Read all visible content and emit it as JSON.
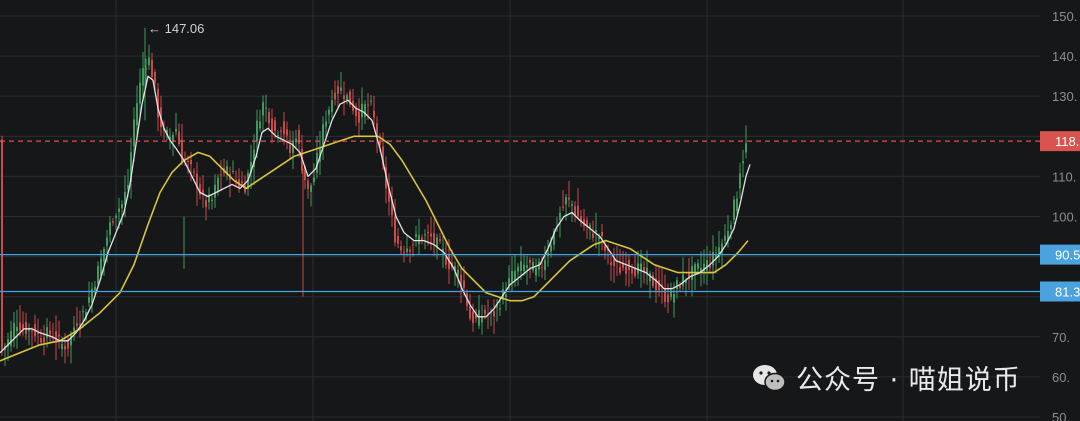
{
  "chart_data": {
    "type": "candlestick",
    "ylim": [
      49,
      154
    ],
    "y_ticks": [
      50,
      60,
      70,
      80,
      90,
      100,
      110,
      120,
      130,
      140,
      150
    ],
    "y_tick_labels": [
      "50.",
      "60.",
      "70.",
      "80.",
      "90.",
      "100.",
      "110.",
      "120.",
      "130.",
      "140.",
      "150."
    ],
    "grid": true,
    "peak_annotation": {
      "label": "← 147.06",
      "value": 147.06
    },
    "horizontal_levels": [
      {
        "value": 118.8,
        "label": "118.",
        "style": "dashed",
        "color": "#d9534f"
      },
      {
        "value": 90.5,
        "label": "90.5",
        "style": "solid",
        "color": "#4aa3df"
      },
      {
        "value": 81.3,
        "label": "81.3",
        "style": "solid",
        "color": "#4aa3df"
      }
    ],
    "price_path": [
      [
        0,
        66
      ],
      [
        8,
        69
      ],
      [
        16,
        74
      ],
      [
        24,
        72
      ],
      [
        32,
        72
      ],
      [
        40,
        70
      ],
      [
        52,
        71
      ],
      [
        60,
        68
      ],
      [
        68,
        68
      ],
      [
        76,
        74
      ],
      [
        84,
        76
      ],
      [
        92,
        82
      ],
      [
        100,
        88
      ],
      [
        108,
        96
      ],
      [
        114,
        101
      ],
      [
        122,
        103
      ],
      [
        128,
        108
      ],
      [
        134,
        124
      ],
      [
        138,
        130
      ],
      [
        143,
        137
      ],
      [
        148,
        140
      ],
      [
        153,
        135
      ],
      [
        158,
        126
      ],
      [
        164,
        120
      ],
      [
        170,
        120
      ],
      [
        176,
        122
      ],
      [
        182,
        115
      ],
      [
        190,
        112
      ],
      [
        198,
        108
      ],
      [
        204,
        103
      ],
      [
        212,
        104
      ],
      [
        220,
        111
      ],
      [
        230,
        111
      ],
      [
        240,
        108
      ],
      [
        246,
        108
      ],
      [
        252,
        115
      ],
      [
        258,
        124
      ],
      [
        263,
        128
      ],
      [
        268,
        126
      ],
      [
        274,
        121
      ],
      [
        282,
        123
      ],
      [
        290,
        116
      ],
      [
        296,
        121
      ],
      [
        302,
        113
      ],
      [
        308,
        106
      ],
      [
        314,
        110
      ],
      [
        320,
        118
      ],
      [
        326,
        125
      ],
      [
        334,
        131
      ],
      [
        340,
        132
      ],
      [
        346,
        130
      ],
      [
        352,
        128
      ],
      [
        358,
        125
      ],
      [
        364,
        127
      ],
      [
        370,
        128
      ],
      [
        376,
        122
      ],
      [
        382,
        113
      ],
      [
        388,
        105
      ],
      [
        394,
        96
      ],
      [
        400,
        92
      ],
      [
        410,
        93
      ],
      [
        420,
        95
      ],
      [
        430,
        95
      ],
      [
        440,
        92
      ],
      [
        450,
        88
      ],
      [
        458,
        86
      ],
      [
        464,
        82
      ],
      [
        470,
        75
      ],
      [
        476,
        74
      ],
      [
        484,
        76
      ],
      [
        492,
        75
      ],
      [
        500,
        79
      ],
      [
        508,
        83
      ],
      [
        514,
        86
      ],
      [
        520,
        87
      ],
      [
        528,
        88
      ],
      [
        536,
        86
      ],
      [
        542,
        88
      ],
      [
        548,
        92
      ],
      [
        554,
        96
      ],
      [
        560,
        101
      ],
      [
        566,
        104
      ],
      [
        572,
        103
      ],
      [
        578,
        100
      ],
      [
        586,
        97
      ],
      [
        594,
        96
      ],
      [
        600,
        95
      ],
      [
        606,
        91
      ],
      [
        612,
        88
      ],
      [
        620,
        87
      ],
      [
        628,
        88
      ],
      [
        636,
        87
      ],
      [
        644,
        86
      ],
      [
        652,
        84
      ],
      [
        660,
        82
      ],
      [
        666,
        80
      ],
      [
        672,
        80
      ],
      [
        678,
        83
      ],
      [
        686,
        85
      ],
      [
        694,
        86
      ],
      [
        700,
        87
      ],
      [
        706,
        88
      ],
      [
        712,
        89
      ],
      [
        718,
        92
      ],
      [
        724,
        94
      ],
      [
        730,
        99
      ],
      [
        736,
        104
      ],
      [
        740,
        112
      ],
      [
        744,
        116
      ],
      [
        748,
        119
      ]
    ],
    "ma_fast": [
      [
        0,
        66
      ],
      [
        8,
        68
      ],
      [
        16,
        70
      ],
      [
        24,
        72
      ],
      [
        32,
        72
      ],
      [
        40,
        71
      ],
      [
        52,
        70
      ],
      [
        60,
        69
      ],
      [
        68,
        69
      ],
      [
        76,
        71
      ],
      [
        84,
        74
      ],
      [
        92,
        78
      ],
      [
        100,
        84
      ],
      [
        108,
        91
      ],
      [
        116,
        96
      ],
      [
        124,
        101
      ],
      [
        130,
        108
      ],
      [
        136,
        118
      ],
      [
        142,
        128
      ],
      [
        148,
        135
      ],
      [
        153,
        134
      ],
      [
        158,
        127
      ],
      [
        164,
        122
      ],
      [
        170,
        119
      ],
      [
        176,
        117
      ],
      [
        184,
        114
      ],
      [
        192,
        110
      ],
      [
        200,
        106
      ],
      [
        208,
        105
      ],
      [
        216,
        106
      ],
      [
        224,
        107
      ],
      [
        232,
        108
      ],
      [
        240,
        107
      ],
      [
        248,
        109
      ],
      [
        256,
        115
      ],
      [
        262,
        121
      ],
      [
        268,
        122
      ],
      [
        276,
        120
      ],
      [
        284,
        119
      ],
      [
        292,
        118
      ],
      [
        300,
        116
      ],
      [
        308,
        110
      ],
      [
        316,
        112
      ],
      [
        324,
        118
      ],
      [
        332,
        124
      ],
      [
        340,
        128
      ],
      [
        348,
        129
      ],
      [
        356,
        127
      ],
      [
        364,
        126
      ],
      [
        372,
        124
      ],
      [
        380,
        117
      ],
      [
        388,
        108
      ],
      [
        396,
        100
      ],
      [
        404,
        96
      ],
      [
        414,
        94
      ],
      [
        424,
        94
      ],
      [
        434,
        93
      ],
      [
        444,
        91
      ],
      [
        454,
        87
      ],
      [
        462,
        82
      ],
      [
        470,
        78
      ],
      [
        478,
        75
      ],
      [
        486,
        75
      ],
      [
        494,
        77
      ],
      [
        502,
        80
      ],
      [
        510,
        83
      ],
      [
        520,
        85
      ],
      [
        530,
        87
      ],
      [
        540,
        88
      ],
      [
        548,
        92
      ],
      [
        556,
        97
      ],
      [
        564,
        100
      ],
      [
        572,
        101
      ],
      [
        580,
        99
      ],
      [
        590,
        97
      ],
      [
        600,
        95
      ],
      [
        608,
        92
      ],
      [
        616,
        89
      ],
      [
        626,
        88
      ],
      [
        636,
        87
      ],
      [
        646,
        86
      ],
      [
        656,
        84
      ],
      [
        664,
        82
      ],
      [
        672,
        82
      ],
      [
        680,
        83
      ],
      [
        690,
        85
      ],
      [
        700,
        86
      ],
      [
        710,
        88
      ],
      [
        718,
        90
      ],
      [
        726,
        93
      ],
      [
        734,
        97
      ],
      [
        740,
        103
      ],
      [
        746,
        110
      ],
      [
        750,
        113
      ]
    ],
    "ma_slow": [
      [
        0,
        64
      ],
      [
        20,
        66
      ],
      [
        40,
        68
      ],
      [
        60,
        69
      ],
      [
        80,
        72
      ],
      [
        100,
        76
      ],
      [
        120,
        81
      ],
      [
        134,
        88
      ],
      [
        148,
        98
      ],
      [
        160,
        106
      ],
      [
        172,
        111
      ],
      [
        184,
        114
      ],
      [
        198,
        116
      ],
      [
        210,
        115
      ],
      [
        222,
        112
      ],
      [
        234,
        109
      ],
      [
        246,
        107
      ],
      [
        258,
        109
      ],
      [
        270,
        111
      ],
      [
        282,
        113
      ],
      [
        294,
        115
      ],
      [
        306,
        116
      ],
      [
        318,
        117
      ],
      [
        330,
        118
      ],
      [
        342,
        119
      ],
      [
        354,
        120
      ],
      [
        366,
        120
      ],
      [
        378,
        120
      ],
      [
        390,
        118
      ],
      [
        402,
        114
      ],
      [
        414,
        109
      ],
      [
        426,
        104
      ],
      [
        438,
        98
      ],
      [
        450,
        92
      ],
      [
        462,
        87
      ],
      [
        474,
        84
      ],
      [
        486,
        81
      ],
      [
        498,
        80
      ],
      [
        510,
        79
      ],
      [
        522,
        79
      ],
      [
        534,
        80
      ],
      [
        546,
        83
      ],
      [
        558,
        86
      ],
      [
        570,
        89
      ],
      [
        582,
        91
      ],
      [
        594,
        93
      ],
      [
        606,
        94
      ],
      [
        618,
        93
      ],
      [
        630,
        92
      ],
      [
        642,
        90
      ],
      [
        654,
        88
      ],
      [
        666,
        87
      ],
      [
        678,
        86
      ],
      [
        690,
        86
      ],
      [
        702,
        86
      ],
      [
        714,
        86
      ],
      [
        726,
        88
      ],
      [
        738,
        91
      ],
      [
        748,
        94
      ]
    ],
    "colors": {
      "up": "#3e9a5e",
      "down": "#c94a4a",
      "ma_fast": "#e3e3e3",
      "ma_slow": "#d8c43a",
      "grid": "#2a2c30",
      "axis_text": "#8a8d93"
    }
  },
  "watermark": {
    "text": "公众号 · 喵姐说币",
    "icon": "wechat-icon"
  }
}
